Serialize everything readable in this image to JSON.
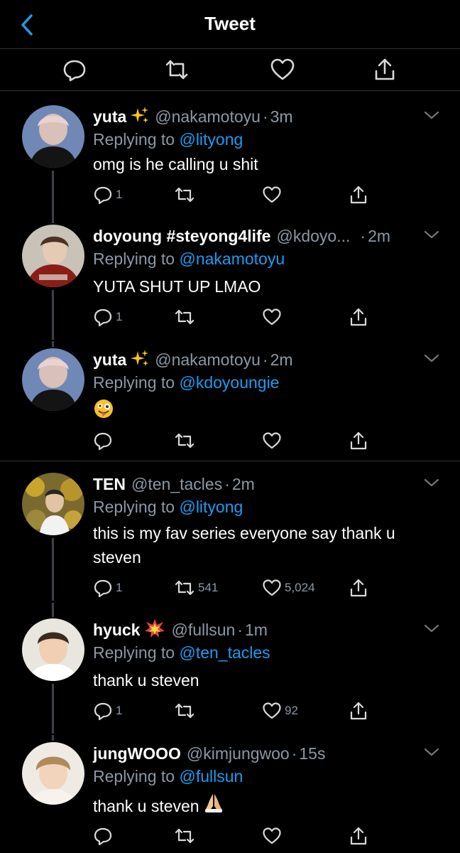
{
  "header": {
    "title": "Tweet"
  },
  "actionbar": [
    "reply",
    "retweet",
    "like",
    "share"
  ],
  "tweets": [
    {
      "name": "yuta",
      "name_emoji": "sparkles",
      "handle": "@nakamotoyu",
      "dot": "·",
      "time": "3m",
      "replying_prefix": "Replying to",
      "replying_to": "@lityong",
      "body": "omg is he calling u shit",
      "replies": "1",
      "retweets": "",
      "likes": ""
    },
    {
      "name": "doyoung #steyong4life",
      "name_emoji": "",
      "handle": "@kdoyo...",
      "dot": "·",
      "time": "2m",
      "replying_prefix": "Replying to",
      "replying_to": "@nakamotoyu",
      "body": "YUTA SHUT UP LMAO",
      "replies": "1",
      "retweets": "",
      "likes": ""
    },
    {
      "name": "yuta",
      "name_emoji": "sparkles",
      "handle": "@nakamotoyu",
      "dot": "·",
      "time": "2m",
      "replying_prefix": "Replying to",
      "replying_to": "@kdoyoungie",
      "body": "",
      "body_emoji": "zany-face",
      "replies": "",
      "retweets": "",
      "likes": ""
    },
    {
      "name": "TEN",
      "name_emoji": "",
      "handle": "@ten_tacles",
      "dot": "·",
      "time": "2m",
      "replying_prefix": "Replying to",
      "replying_to": "@lityong",
      "body": "this is my fav series everyone say thank u steven",
      "replies": "1",
      "retweets": "541",
      "likes": "5,024"
    },
    {
      "name": "hyuck",
      "name_emoji": "collision",
      "handle": "@fullsun",
      "dot": "·",
      "time": "1m",
      "replying_prefix": "Replying to",
      "replying_to": "@ten_tacles",
      "body": "thank u steven",
      "replies": "1",
      "retweets": "",
      "likes": "92"
    },
    {
      "name": "jungWOOO",
      "name_emoji": "",
      "handle": "@kimjungwoo",
      "dot": "·",
      "time": "15s",
      "replying_prefix": "Replying to",
      "replying_to": "@fullsun",
      "body": "thank u steven",
      "body_emoji": "folded-hands",
      "replies": "",
      "retweets": "",
      "likes": ""
    }
  ]
}
